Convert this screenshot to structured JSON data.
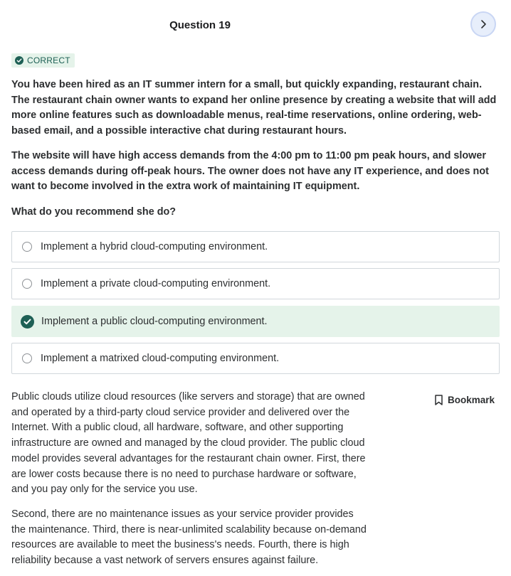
{
  "header": {
    "question_title": "Question 19",
    "next_icon": "chevron-right-icon"
  },
  "status": {
    "badge_label": "CORRECT",
    "badge_icon": "check-circle-icon",
    "color": "#1e6055"
  },
  "question": {
    "paragraphs": [
      "You have been hired as an IT summer intern for a small, but quickly expanding, restaurant chain. The restaurant chain owner wants to expand her online presence by creating a website that will add more online features such as downloadable menus, real-time reservations, online ordering, web-based email, and a possible interactive chat during restaurant hours.",
      "The website will have high access demands from the 4:00 pm to 11:00 pm peak hours, and slower access demands during off-peak hours. The owner does not have any IT experience, and does not want to become involved in the extra work of maintaining IT equipment.",
      "What do you recommend she do?"
    ]
  },
  "options": [
    {
      "label": "Implement a hybrid cloud-computing environment.",
      "selected": false
    },
    {
      "label": "Implement a private cloud-computing environment.",
      "selected": false
    },
    {
      "label": "Implement a public cloud-computing environment.",
      "selected": true
    },
    {
      "label": "Implement a matrixed cloud-computing environment.",
      "selected": false
    }
  ],
  "explanation": {
    "paragraphs": [
      "Public clouds utilize cloud resources (like servers and storage) that are owned and operated by a third-party cloud service provider and delivered over the Internet. With a public cloud, all hardware, software, and other supporting infrastructure are owned and managed by the cloud provider. The public cloud model provides several advantages for the restaurant chain owner. First, there are lower costs because there is no need to purchase hardware or software, and you pay only for the service you use.",
      "Second, there are no maintenance issues as your service provider provides the maintenance. Third, there is near-unlimited scalability because on-demand resources are available to meet the business's needs. Fourth, there is high reliability because a vast network of servers ensures against failure."
    ]
  },
  "bookmark": {
    "label": "Bookmark",
    "icon": "bookmark-icon"
  },
  "colors": {
    "accent": "#1e6055",
    "selected_bg": "#e5f3ea",
    "next_button_bg": "#e7eefb"
  }
}
